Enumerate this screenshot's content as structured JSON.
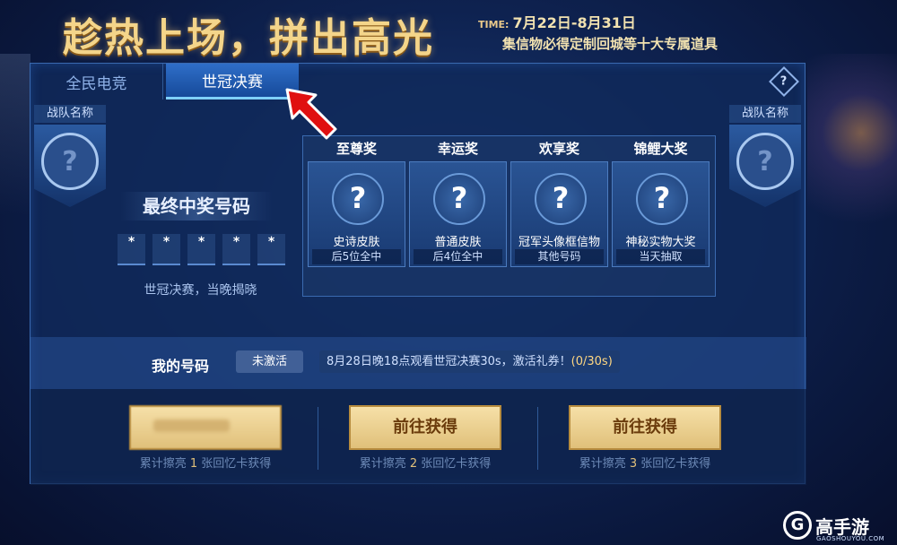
{
  "banner": {
    "title": "趁热上场，拼出高光",
    "time_label": "TIME:",
    "time_value": "7月22日-8月31日",
    "subtitle": "集信物必得定制回城等十大专属道具"
  },
  "tabs": [
    {
      "label": "全民电竞"
    },
    {
      "label": "世冠决赛"
    }
  ],
  "help": {
    "symbol": "?"
  },
  "teams": {
    "left_label": "战队名称",
    "right_label": "战队名称",
    "placeholder": "?"
  },
  "final_number": {
    "title": "最终中奖号码",
    "digits": [
      "*",
      "*",
      "*",
      "*",
      "*"
    ],
    "note": "世冠决赛，当晚揭晓"
  },
  "prizes": [
    {
      "title": "至尊奖",
      "icon": "?",
      "name": "史诗皮肤",
      "condition": "后5位全中"
    },
    {
      "title": "幸运奖",
      "icon": "?",
      "name": "普通皮肤",
      "condition": "后4位全中"
    },
    {
      "title": "欢享奖",
      "icon": "?",
      "name": "冠军头像框信物",
      "condition": "其他号码"
    },
    {
      "title": "锦鲤大奖",
      "icon": "?",
      "name": "神秘实物大奖",
      "condition": "当天抽取"
    }
  ],
  "my_number": {
    "label": "我的号码",
    "status": "未激活",
    "task": "8月28日晚18点观看世冠决赛30s，激活礼券！",
    "progress": "(0/30s)"
  },
  "tickets": [
    {
      "button": "",
      "note_prefix": "累计擦亮",
      "count": "1",
      "note_suffix": "张回忆卡获得"
    },
    {
      "button": "前往获得",
      "note_prefix": "累计擦亮",
      "count": "2",
      "note_suffix": "张回忆卡获得"
    },
    {
      "button": "前往获得",
      "note_prefix": "累计擦亮",
      "count": "3",
      "note_suffix": "张回忆卡获得"
    }
  ],
  "watermark": {
    "logo": "G",
    "text": "高手游",
    "sub": "GAOSHOUYOU.COM"
  },
  "colors": {
    "accent_gold": "#f4d58a",
    "panel_bg": "#102a5a",
    "arrow_red": "#e01010"
  }
}
